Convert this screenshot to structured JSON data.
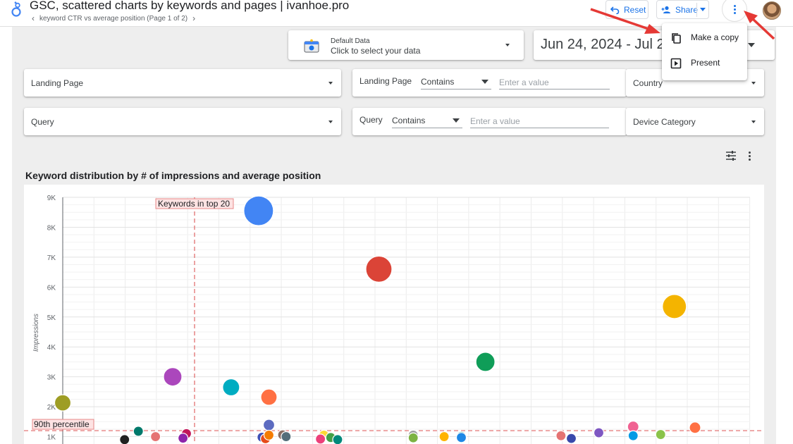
{
  "header": {
    "title": "GSC, scattered charts by keywords and pages | ivanhoe.pro",
    "page_label": "keyword CTR vs average position (Page 1 of 2)",
    "reset_label": "Reset",
    "share_label": "Share"
  },
  "menu": {
    "items": [
      {
        "label": "Make a copy",
        "icon": "copy-icon"
      },
      {
        "label": "Present",
        "icon": "present-icon"
      }
    ]
  },
  "data_source": {
    "name": "Default Data",
    "hint": "Click to select your data"
  },
  "date_range": {
    "text": "Jun 24, 2024 - Jul 2"
  },
  "controls": {
    "landing_page_dropdown": "Landing Page",
    "query_dropdown": "Query",
    "country_dropdown": "Country",
    "device_dropdown": "Device Category",
    "landing_filter": {
      "label": "Landing Page",
      "operator": "Contains",
      "placeholder": "Enter a value"
    },
    "query_filter": {
      "label": "Query",
      "operator": "Contains",
      "placeholder": "Enter a value"
    }
  },
  "chart_data": {
    "type": "scatter",
    "title": "Keyword distribution by # of impressions and average position",
    "ylabel": "Impressions",
    "xlabel": "",
    "ylim": [
      0,
      9000
    ],
    "y_ticks": [
      "1K",
      "2K",
      "3K",
      "4K",
      "5K",
      "6K",
      "7K",
      "8K",
      "9K"
    ],
    "grid": true,
    "annotations": {
      "vertical_line_label": "Keywords in top 20",
      "horizontal_line_label": "90th percentile",
      "horizontal_line_value": 1200,
      "line_color": "#e06666"
    },
    "points": [
      {
        "x": 28.5,
        "y": 8550,
        "r": 21,
        "color": "#4285f4"
      },
      {
        "x": 46,
        "y": 6600,
        "r": 18.5,
        "color": "#db4437"
      },
      {
        "x": 89,
        "y": 5350,
        "r": 17,
        "color": "#f4b400"
      },
      {
        "x": 61.5,
        "y": 3500,
        "r": 13.5,
        "color": "#0f9d58"
      },
      {
        "x": 16,
        "y": 3000,
        "r": 13,
        "color": "#ab47bc"
      },
      {
        "x": 24.5,
        "y": 2650,
        "r": 12,
        "color": "#00acc1"
      },
      {
        "x": 30,
        "y": 2320,
        "r": 11.5,
        "color": "#ff7043"
      },
      {
        "x": 0,
        "y": 2130,
        "r": 11.5,
        "color": "#9e9d24"
      },
      {
        "x": 30,
        "y": 1390,
        "r": 8,
        "color": "#5c6bc0"
      },
      {
        "x": 18,
        "y": 1100,
        "r": 7,
        "color": "#c2185b"
      },
      {
        "x": 11,
        "y": 1180,
        "r": 7,
        "color": "#00796b"
      },
      {
        "x": 13.5,
        "y": 1000,
        "r": 7,
        "color": "#e57373"
      },
      {
        "x": 17.5,
        "y": 950,
        "r": 7,
        "color": "#8e24aa"
      },
      {
        "x": 29,
        "y": 980,
        "r": 7,
        "color": "#3f51b5"
      },
      {
        "x": 29.5,
        "y": 930,
        "r": 7,
        "color": "#e64a19"
      },
      {
        "x": 30,
        "y": 1050,
        "r": 7,
        "color": "#f57c00"
      },
      {
        "x": 32,
        "y": 1060,
        "r": 7,
        "color": "#8d6e63"
      },
      {
        "x": 32.5,
        "y": 1000,
        "r": 7,
        "color": "#546e7a"
      },
      {
        "x": 38,
        "y": 1050,
        "r": 7,
        "color": "#fdd835"
      },
      {
        "x": 39,
        "y": 970,
        "r": 7,
        "color": "#43a047"
      },
      {
        "x": 37.5,
        "y": 920,
        "r": 7,
        "color": "#ec407a"
      },
      {
        "x": 40,
        "y": 900,
        "r": 7,
        "color": "#00897b"
      },
      {
        "x": 51,
        "y": 1050,
        "r": 7,
        "color": "#9e9e9e"
      },
      {
        "x": 51,
        "y": 960,
        "r": 7,
        "color": "#7cb342"
      },
      {
        "x": 55.5,
        "y": 1000,
        "r": 7,
        "color": "#ffb300"
      },
      {
        "x": 58,
        "y": 1010,
        "r": 7,
        "color": "#26a69a"
      },
      {
        "x": 58,
        "y": 970,
        "r": 7,
        "color": "#1e88e5"
      },
      {
        "x": 72.5,
        "y": 1030,
        "r": 7,
        "color": "#e57373"
      },
      {
        "x": 74,
        "y": 940,
        "r": 7,
        "color": "#3949ab"
      },
      {
        "x": 78,
        "y": 1130,
        "r": 7,
        "color": "#7e57c2"
      },
      {
        "x": 83,
        "y": 1330,
        "r": 8,
        "color": "#f06292"
      },
      {
        "x": 83,
        "y": 1030,
        "r": 7,
        "color": "#039be5"
      },
      {
        "x": 87,
        "y": 1070,
        "r": 7,
        "color": "#8bc34a"
      },
      {
        "x": 92,
        "y": 1300,
        "r": 8,
        "color": "#ff7043"
      },
      {
        "x": 9,
        "y": 900,
        "r": 7,
        "color": "#212121"
      }
    ]
  }
}
